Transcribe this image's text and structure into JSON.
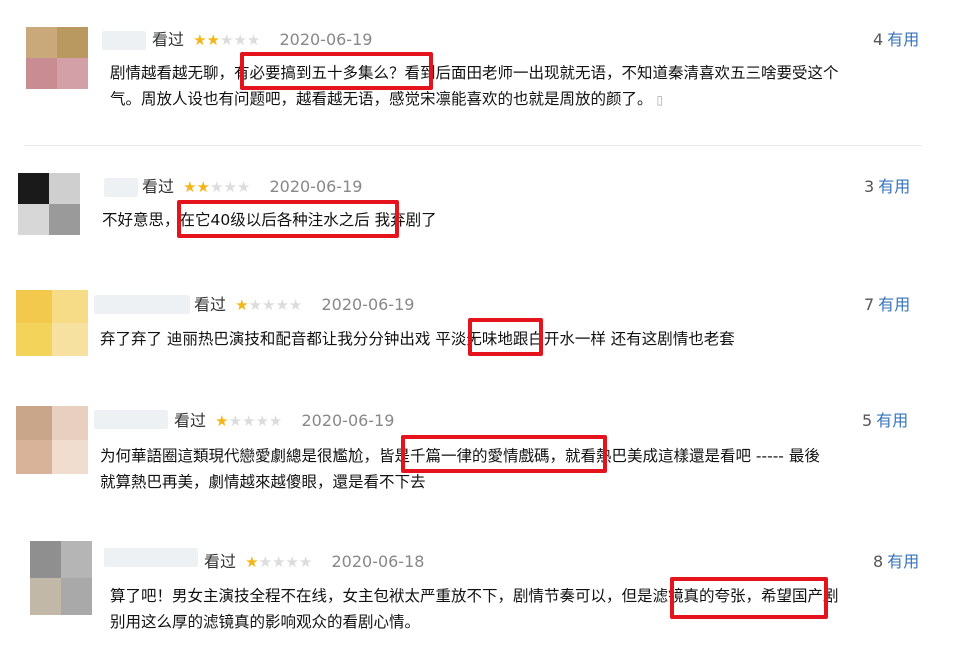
{
  "reviews": [
    {
      "tag": "看过",
      "rating": 2,
      "date": "2020-06-19",
      "votes": "4",
      "useful_label": "有用",
      "text_line1": "剧情越看越无聊，有必要搞到五十多集么？看到后面田老师一出现就无语，不知道秦清喜欢五三啥要受这个",
      "text_line2": "气。周放人设也有问题吧，越看越无语，感觉宋凛能喜欢的也就是周放的颜了。",
      "device_icon": "phone-icon"
    },
    {
      "tag": "看过",
      "rating": 2,
      "date": "2020-06-19",
      "votes": "3",
      "useful_label": "有用",
      "text_line1": "不好意思，在它40级以后各种注水之后 我弃剧了"
    },
    {
      "tag": "看过",
      "rating": 1,
      "date": "2020-06-19",
      "votes": "7",
      "useful_label": "有用",
      "text_line1": "弃了弃了 迪丽热巴演技和配音都让我分分钟出戏 平淡无味地跟白开水一样 还有这剧情也老套"
    },
    {
      "tag": "看过",
      "rating": 1,
      "date": "2020-06-19",
      "votes": "5",
      "useful_label": "有用",
      "text_line1": "为何華語圈這類現代戀愛劇總是很尷尬，皆是千篇一律的愛情戲碼，就看熱巴美成這樣還是看吧 ----- 最後",
      "text_line2": "就算熱巴再美，劇情越來越傻眼，還是看不下去"
    },
    {
      "tag": "看过",
      "rating": 1,
      "date": "2020-06-18",
      "votes": "8",
      "useful_label": "有用",
      "text_line1": "算了吧！男女主演技全程不在线，女主包袱太严重放不下，剧情节奏可以，但是滤镜真的夸张，希望国产剧",
      "text_line2": "别用这么厚的滤镜真的影响观众的看剧心情。"
    }
  ],
  "colors": {
    "highlight": "#e5131c",
    "star_on": "#f3b518",
    "star_off": "#dcdcdc",
    "useful": "#3773b9"
  }
}
